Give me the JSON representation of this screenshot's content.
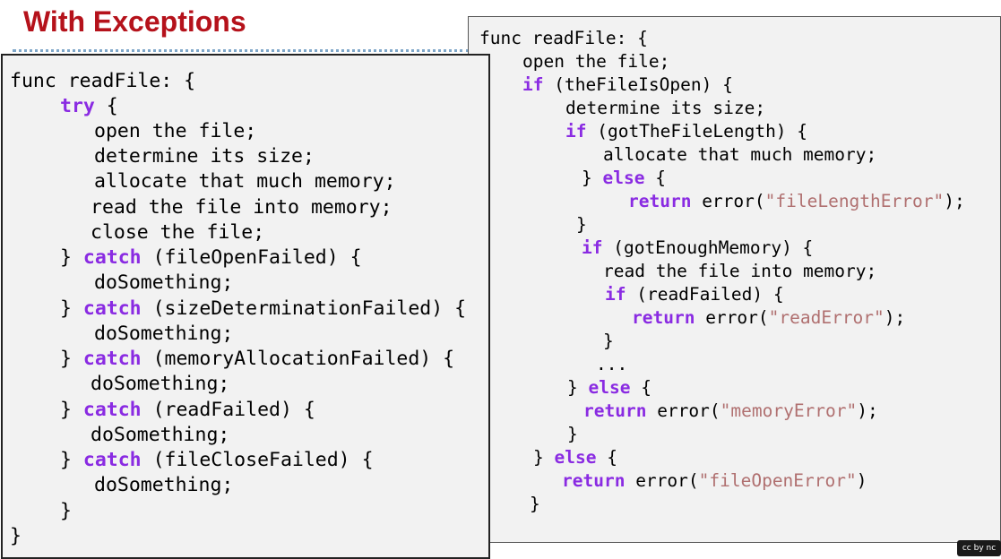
{
  "title": "With Exceptions",
  "left_code": [
    [
      "",
      [
        [
          "t",
          "func readFile: {"
        ]
      ]
    ],
    [
      "",
      [
        [
          "k",
          "try"
        ],
        [
          "t",
          " {"
        ]
      ]
    ],
    [
      "",
      [
        [
          "t",
          "open the file;"
        ]
      ]
    ],
    [
      "",
      [
        [
          "t",
          "determine its size;"
        ]
      ]
    ],
    [
      "",
      [
        [
          "t",
          "allocate that much memory;"
        ]
      ]
    ],
    [
      "",
      [
        [
          "t",
          "read the file into memory;"
        ]
      ]
    ],
    [
      "",
      [
        [
          "t",
          "close the file;"
        ]
      ]
    ],
    [
      "",
      [
        [
          "t",
          "} "
        ],
        [
          "k",
          "catch"
        ],
        [
          "t",
          " (fileOpenFailed) {"
        ]
      ]
    ],
    [
      "",
      [
        [
          "t",
          "doSomething;"
        ]
      ]
    ],
    [
      "",
      [
        [
          "t",
          "} "
        ],
        [
          "k",
          "catch"
        ],
        [
          "t",
          " (sizeDeterminationFailed) {"
        ]
      ]
    ],
    [
      "",
      [
        [
          "t",
          "doSomething;"
        ]
      ]
    ],
    [
      "",
      [
        [
          "t",
          "} "
        ],
        [
          "k",
          "catch"
        ],
        [
          "t",
          " (memoryAllocationFailed) {"
        ]
      ]
    ],
    [
      "",
      [
        [
          "t",
          "doSomething;"
        ]
      ]
    ],
    [
      "",
      [
        [
          "t",
          "} "
        ],
        [
          "k",
          "catch"
        ],
        [
          "t",
          " (readFailed) {"
        ]
      ]
    ],
    [
      "",
      [
        [
          "t",
          "doSomething;"
        ]
      ]
    ],
    [
      "",
      [
        [
          "t",
          "} "
        ],
        [
          "k",
          "catch"
        ],
        [
          "t",
          " (fileCloseFailed) {"
        ]
      ]
    ],
    [
      "",
      [
        [
          "t",
          "doSomething;"
        ]
      ]
    ],
    [
      "",
      [
        [
          "t",
          "}"
        ]
      ]
    ],
    [
      "",
      [
        [
          "t",
          "}"
        ]
      ]
    ]
  ],
  "right_code": [
    [
      "",
      [
        [
          "t",
          "func readFile: {"
        ]
      ]
    ],
    [
      "",
      [
        [
          "t",
          "open the file;"
        ]
      ]
    ],
    [
      "",
      [
        [
          "k",
          "if"
        ],
        [
          "t",
          " (theFileIsOpen) {"
        ]
      ]
    ],
    [
      "",
      [
        [
          "t",
          "determine its size;"
        ]
      ]
    ],
    [
      "",
      [
        [
          "k",
          "if"
        ],
        [
          "t",
          " (gotTheFileLength) {"
        ]
      ]
    ],
    [
      "",
      [
        [
          "t",
          "allocate that much memory;"
        ]
      ]
    ],
    [
      "",
      [
        [
          "t",
          "} "
        ],
        [
          "k",
          "else"
        ],
        [
          "t",
          " {"
        ]
      ]
    ],
    [
      "",
      [
        [
          "k",
          "return"
        ],
        [
          "t",
          " error("
        ],
        [
          "s",
          "\"fileLengthError\""
        ],
        [
          "t",
          ");"
        ]
      ]
    ],
    [
      "",
      [
        [
          "t",
          "}"
        ]
      ]
    ],
    [
      "",
      [
        [
          "k",
          "if"
        ],
        [
          "t",
          " (gotEnoughMemory) {"
        ]
      ]
    ],
    [
      "",
      [
        [
          "t",
          "read the file into memory;"
        ]
      ]
    ],
    [
      "",
      [
        [
          "k",
          "if"
        ],
        [
          "t",
          " (readFailed) {"
        ]
      ]
    ],
    [
      "",
      [
        [
          "k",
          "return"
        ],
        [
          "t",
          " error("
        ],
        [
          "s",
          "\"readError\""
        ],
        [
          "t",
          ");"
        ]
      ]
    ],
    [
      "",
      [
        [
          "t",
          "}"
        ]
      ]
    ],
    [
      "",
      [
        [
          "t",
          "..."
        ]
      ]
    ],
    [
      "",
      [
        [
          "t",
          "} "
        ],
        [
          "k",
          "else"
        ],
        [
          "t",
          " {"
        ]
      ]
    ],
    [
      "",
      [
        [
          "k",
          "return"
        ],
        [
          "t",
          " error("
        ],
        [
          "s",
          "\"memoryError\""
        ],
        [
          "t",
          ");"
        ]
      ]
    ],
    [
      "",
      [
        [
          "t",
          "}"
        ]
      ]
    ],
    [
      "",
      [
        [
          "t",
          "} "
        ],
        [
          "k",
          "else"
        ],
        [
          "t",
          " {"
        ]
      ]
    ],
    [
      "",
      [
        [
          "k",
          "return"
        ],
        [
          "t",
          " error("
        ],
        [
          "s",
          "\"fileOpenError\""
        ],
        [
          "t",
          ")"
        ]
      ]
    ],
    [
      "",
      [
        [
          "t",
          "}"
        ]
      ]
    ]
  ],
  "license_badge": "cc by nc"
}
